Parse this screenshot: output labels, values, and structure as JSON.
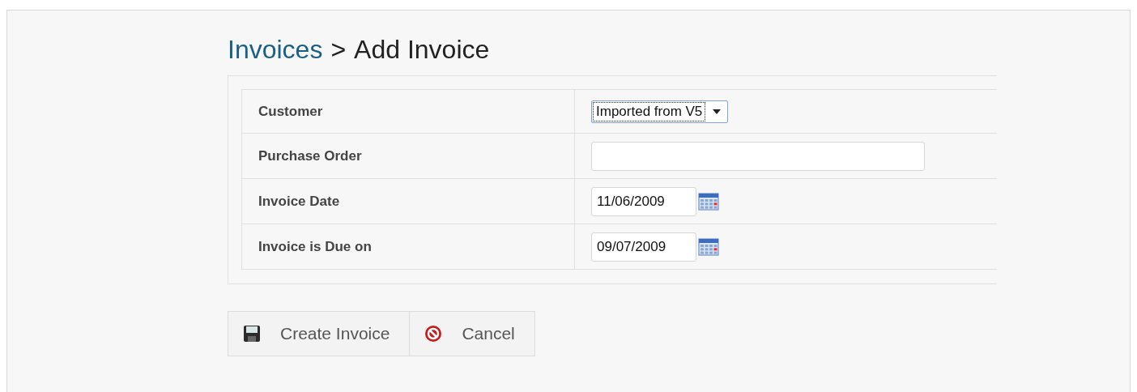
{
  "breadcrumb": {
    "parent": "Invoices",
    "separator": ">",
    "current": "Add Invoice"
  },
  "fields": [
    {
      "label": "Customer",
      "kind": "select",
      "value": "Imported from V5"
    },
    {
      "label": "Purchase Order",
      "kind": "text"
    },
    {
      "label": "Invoice Date",
      "kind": "date",
      "value": "11/06/2009"
    },
    {
      "label": "Invoice is Due on",
      "kind": "date",
      "value": "09/07/2009"
    }
  ],
  "buttons": [
    {
      "label": "Create Invoice",
      "kind": "save"
    },
    {
      "label": "Cancel",
      "kind": "cancel"
    }
  ]
}
